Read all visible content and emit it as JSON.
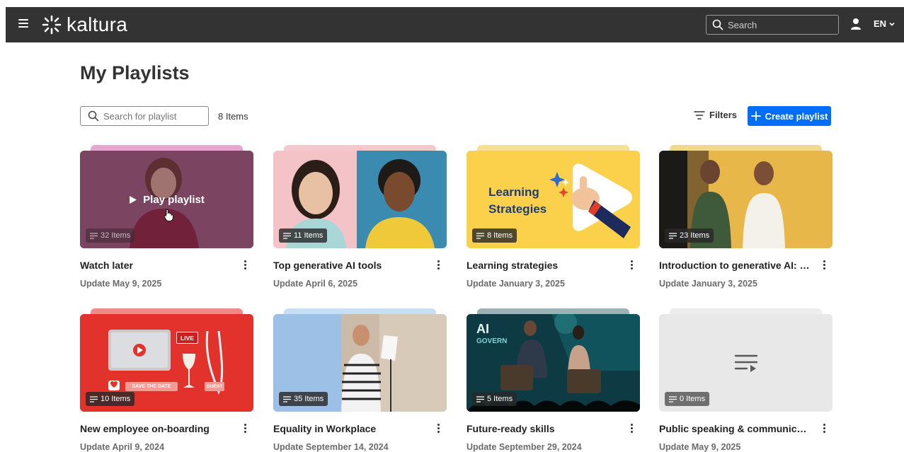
{
  "header": {
    "brand": "kaltura",
    "search_placeholder": "Search",
    "language": "EN"
  },
  "page": {
    "title": "My Playlists",
    "search_placeholder": "Search for playlist",
    "item_count": "8 Items",
    "filters_label": "Filters",
    "create_label": "Create playlist"
  },
  "playlists": [
    {
      "title": "Watch later",
      "date": "Update May 9, 2025",
      "items": "32 Items",
      "hover_label": "Play playlist",
      "accent": "#e7a6cf"
    },
    {
      "title": "Top generative AI tools",
      "date": "Update April 6, 2025",
      "items": "11 Items",
      "accent": "#f4c9cd"
    },
    {
      "title": "Learning strategies",
      "date": "Update January 3, 2025",
      "items": "8 Items",
      "thumb_text_1": "Learning",
      "thumb_text_2": "Strategies",
      "accent": "#f6e18e"
    },
    {
      "title": "Introduction to generative AI: U...",
      "date": "Update January 3, 2025",
      "items": "23 Items",
      "accent": "#f0d98a"
    },
    {
      "title": "New employee on-boarding",
      "date": "Update April 9, 2024",
      "items": "10 Items",
      "thumb_live": "LIVE",
      "thumb_save": "SAVE THE DATE",
      "thumb_guest": "GUEST",
      "accent": "#ef8a86"
    },
    {
      "title": "Equality in Workplace",
      "date": "Update September 14, 2024",
      "items": "35 Items",
      "accent": "#c8def4"
    },
    {
      "title": "Future-ready skills",
      "date": "Update September 29, 2024",
      "items": "5 Items",
      "thumb_text_1": "AI",
      "thumb_text_2": "GOVERN",
      "accent": "#9bb3b4"
    },
    {
      "title": "Public speaking & communicatio...",
      "date": "Update May 9, 2025",
      "items": "0 Items",
      "accent": "#ededed"
    }
  ]
}
